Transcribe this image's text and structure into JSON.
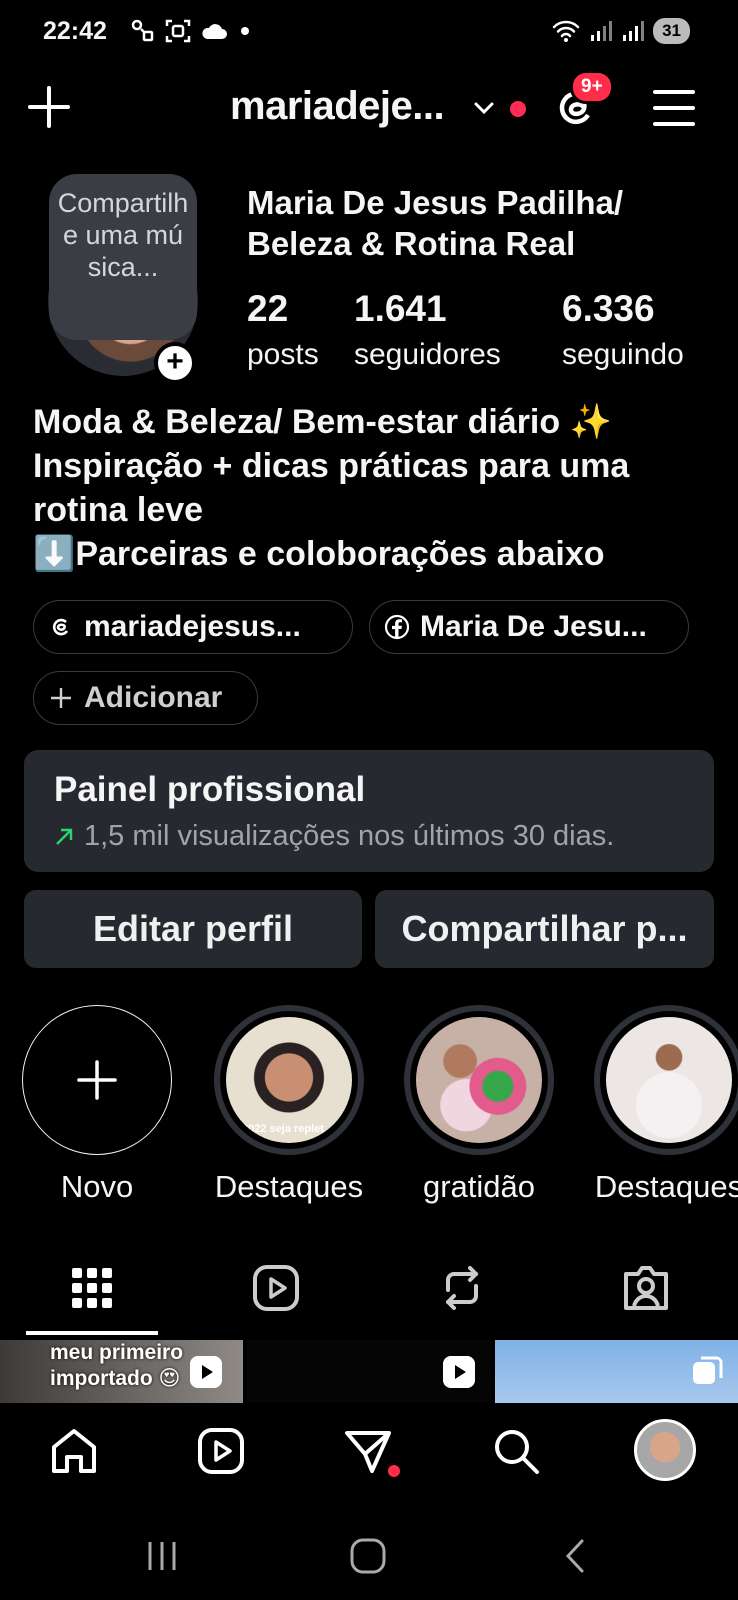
{
  "status_bar": {
    "time": "22:42",
    "battery": "31"
  },
  "header": {
    "username": "mariadeje...",
    "notification_badge": "9+"
  },
  "profile": {
    "music_prompt": "Compartilhe uma música...",
    "full_name": "Maria De Jesus Padilha/ Beleza & Rotina Real",
    "stats": [
      {
        "value": "22",
        "label": "posts"
      },
      {
        "value": "1.641",
        "label": "seguidores"
      },
      {
        "value": "6.336",
        "label": "seguindo"
      }
    ],
    "bio": [
      "Moda & Beleza/ Bem-estar diário ✨",
      "Inspiração + dicas práticas para uma",
      "rotina leve",
      "⬇️Parceiras e coloborações abaixo"
    ],
    "links": {
      "threads": "mariadejesus...",
      "facebook": "Maria De Jesu...",
      "add": "Adicionar"
    }
  },
  "dashboard": {
    "title": "Painel profissional",
    "subtitle": "1,5 mil visualizações nos últimos 30 dias.",
    "trend_color": "#2bd46a"
  },
  "actions": {
    "edit": "Editar perfil",
    "share": "Compartilhar p..."
  },
  "highlights": [
    {
      "label": "Novo"
    },
    {
      "label": "Destaques",
      "overlay_text": "2022 seja replet"
    },
    {
      "label": "gratidão"
    },
    {
      "label": "Destaques"
    }
  ],
  "grid": {
    "first_caption_line1": "meu primeiro",
    "first_caption_line2": "importado 😍"
  },
  "colors": {
    "background": "#000000",
    "card": "#262a30",
    "accent_red": "#ff2d4a"
  }
}
